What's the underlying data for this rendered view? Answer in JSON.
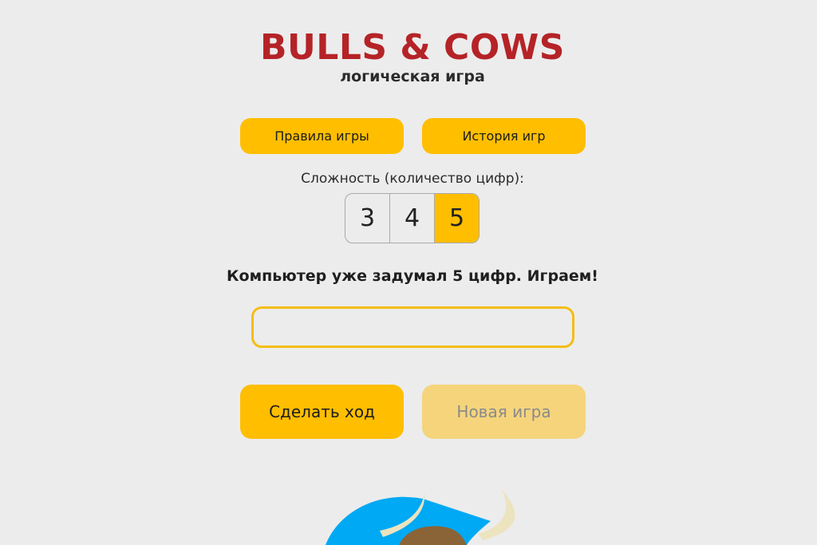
{
  "header": {
    "title": "BULLS & COWS",
    "subtitle": "логическая игра"
  },
  "top_buttons": {
    "rules_label": "Правила игры",
    "history_label": "История игр"
  },
  "difficulty": {
    "label": "Сложность (количество цифр):",
    "options": [
      "3",
      "4",
      "5"
    ],
    "selected": "5"
  },
  "status": {
    "message": "Компьютер уже задумал 5 цифр. Играем!"
  },
  "guess_input": {
    "value": "",
    "placeholder": ""
  },
  "actions": {
    "make_move_label": "Сделать ход",
    "new_game_label": "Новая игра",
    "new_game_enabled": false
  },
  "mascot": {
    "icon": "bull-mascot-icon"
  },
  "colors": {
    "background": "#ececec",
    "title": "#b52327",
    "accent": "#ffbe00",
    "accent_disabled": "#f5d47c",
    "input_border": "#f5bd12",
    "mascot_cap": "#00a9f4",
    "mascot_horn": "#ece3bf",
    "mascot_fur": "#8a6436"
  }
}
